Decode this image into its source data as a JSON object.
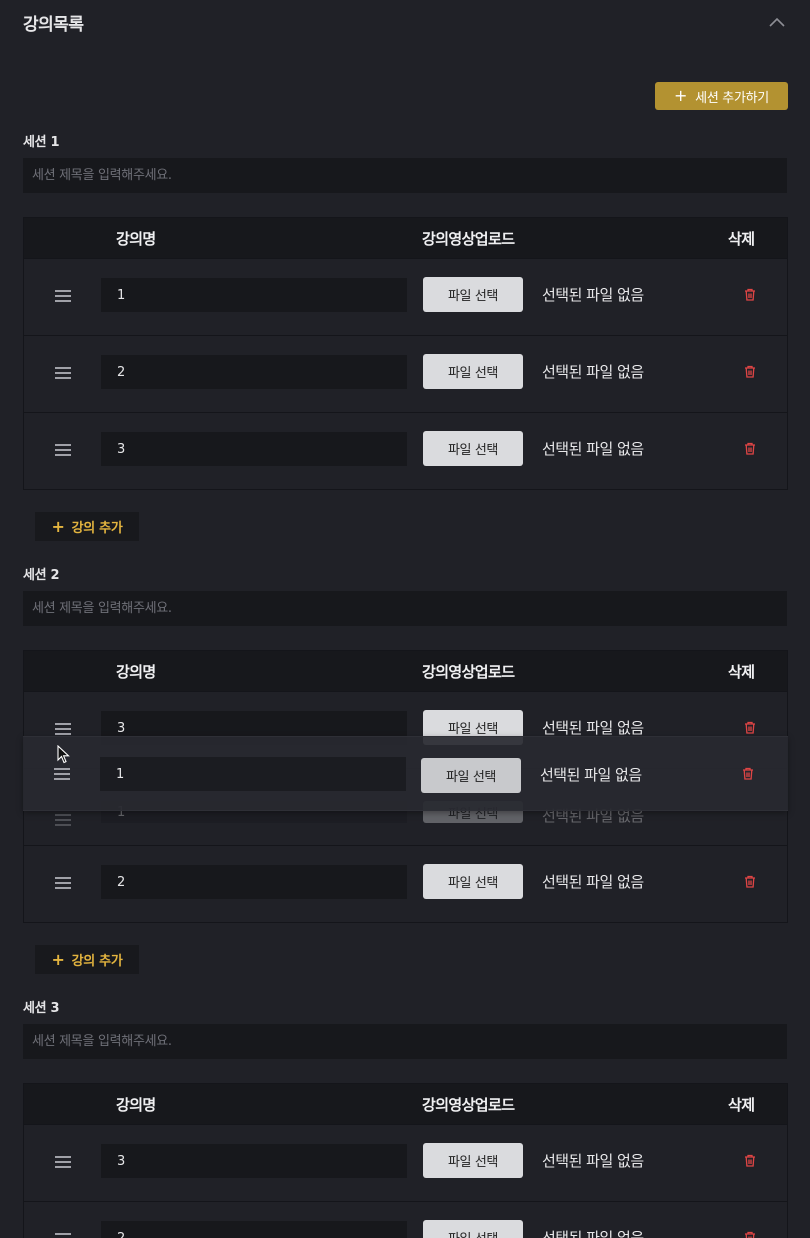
{
  "header": {
    "title": "강의목록",
    "collapse_icon": "chevron-up-icon"
  },
  "toolbar": {
    "add_session_label": "세션 추가하기"
  },
  "table_headers": {
    "name": "강의명",
    "upload": "강의영상업로드",
    "delete": "삭제"
  },
  "session_placeholder": "세션 제목을 입력해주세요.",
  "file_button_label": "파일 선택",
  "file_status_text": "선택된 파일 없음",
  "add_lecture_label": "강의 추가",
  "colors": {
    "accent": "#b39231",
    "add_lecture_text": "#e3b43f",
    "trash": "#e04545",
    "background": "#202127"
  },
  "sessions": [
    {
      "label": "세션 1",
      "title_value": "",
      "lectures": [
        {
          "name": "1"
        },
        {
          "name": "2"
        },
        {
          "name": "3"
        }
      ]
    },
    {
      "label": "세션 2",
      "title_value": "",
      "lectures": [
        {
          "name": "3"
        },
        {
          "name": "1"
        },
        {
          "name": "2"
        }
      ]
    },
    {
      "label": "세션 3",
      "title_value": "",
      "lectures": [
        {
          "name": "3"
        },
        {
          "name": "2"
        }
      ]
    }
  ],
  "drag_ghost": {
    "name": "1"
  }
}
